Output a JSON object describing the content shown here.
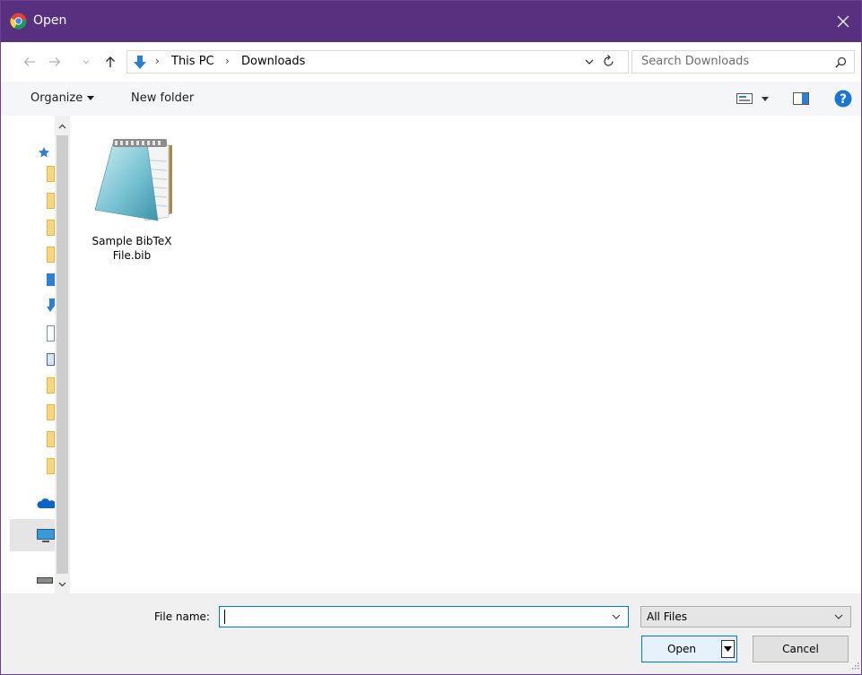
{
  "window": {
    "title": "Open",
    "app_icon": "chrome-icon",
    "title_bar_color": "#57307f"
  },
  "address": {
    "crumbs": [
      "This PC",
      "Downloads"
    ],
    "location_icon": "downloads-icon",
    "search_placeholder": "Search Downloads"
  },
  "toolbar": {
    "organize_label": "Organize",
    "new_folder_label": "New folder"
  },
  "nav_pane": {
    "icons": [
      "quick-access-star-icon",
      "folder-icon",
      "folder-icon",
      "folder-icon",
      "folder-icon",
      "desktop-icon",
      "downloads-icon",
      "document-icon",
      "pictures-icon",
      "folder-icon",
      "folder-icon",
      "folder-icon",
      "folder-icon",
      "onedrive-icon",
      "this-pc-icon",
      "drive-icon"
    ]
  },
  "files": [
    {
      "name": "Sample BibTeX File.bib",
      "name_line1": "Sample BibTeX",
      "name_line2": "File.bib",
      "icon": "notepad-file-icon"
    }
  ],
  "bottom": {
    "file_name_label": "File name:",
    "file_name_value": "",
    "filter_value": "All Files",
    "open_label": "Open",
    "cancel_label": "Cancel"
  }
}
